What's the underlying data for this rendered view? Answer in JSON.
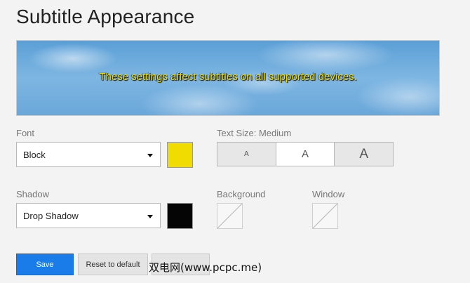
{
  "page": {
    "title": "Subtitle Appearance"
  },
  "preview": {
    "text": "These settings affect subtitles on all supported devices."
  },
  "font": {
    "label": "Font",
    "selected": "Block",
    "color": "#f0dc00"
  },
  "text_size": {
    "label": "Text Size: Medium",
    "options": [
      "A",
      "A",
      "A"
    ],
    "selected_index": 1
  },
  "shadow": {
    "label": "Shadow",
    "selected": "Drop Shadow",
    "color": "#050505"
  },
  "background": {
    "label": "Background",
    "value": "none"
  },
  "window": {
    "label": "Window",
    "value": "none"
  },
  "buttons": {
    "save": "Save",
    "reset": "Reset to default"
  },
  "watermark": {
    "text": "双电网(www.pcpc.me)"
  },
  "colors": {
    "accent": "#1a7ce8",
    "subtitle_text": "#f0dc00"
  }
}
